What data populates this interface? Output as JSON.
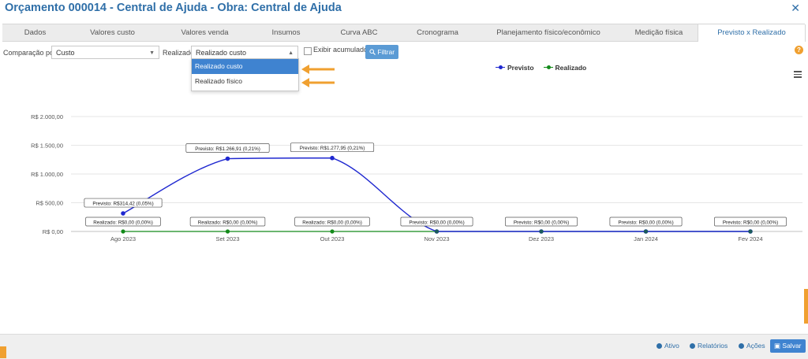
{
  "window": {
    "title": "Orçamento 000014 - Central de Ajuda - Obra: Central de Ajuda",
    "close_icon": "✕"
  },
  "tabs": [
    {
      "label": "Dados"
    },
    {
      "label": "Valores custo"
    },
    {
      "label": "Valores venda"
    },
    {
      "label": "Insumos"
    },
    {
      "label": "Curva ABC"
    },
    {
      "label": "Cronograma"
    },
    {
      "label": "Planejamento físico/econômico"
    },
    {
      "label": "Medição física"
    },
    {
      "label": "Previsto x Realizado"
    }
  ],
  "filters": {
    "comparacao_label": "Comparação por",
    "comparacao_value": "Custo",
    "realizado_label": "Realizado",
    "realizado_value": "Realizado custo",
    "realizado_options": [
      "Realizado custo",
      "Realizado físico"
    ],
    "exibir_acumulado_label": "Exibir acumulado",
    "filtrar_label": "Filtrar"
  },
  "colors": {
    "accent": "#2f6fa8",
    "previsto": "#1f28d0",
    "realizado": "#138a1a",
    "arrow": "#f0a030"
  },
  "chart_data": {
    "type": "line",
    "categories": [
      "Ago 2023",
      "Set 2023",
      "Out 2023",
      "Nov 2023",
      "Dez 2023",
      "Jan 2024",
      "Fev 2024"
    ],
    "y_ticks": [
      "R$ 0,00",
      "R$ 500,00",
      "R$ 1.000,00",
      "R$ 1.500,00",
      "R$ 2.000,00"
    ],
    "ylim": [
      0,
      2000
    ],
    "grid": true,
    "legend_position": "top-center",
    "series": [
      {
        "name": "Previsto",
        "values": [
          314.42,
          1266.91,
          1277.95,
          0,
          0,
          0,
          0
        ],
        "labels": [
          "Previsto: R$314,42 (0,05%)",
          "Previsto: R$1.266,91 (0,21%)",
          "Previsto: R$1.277,95 (0,21%)",
          "Previsto: R$0,00 (0,00%)",
          "Previsto: R$0,00 (0,00%)",
          "Previsto: R$0,00 (0,00%)",
          "Previsto: R$0,00 (0,00%)"
        ]
      },
      {
        "name": "Realizado",
        "values": [
          0,
          0,
          0,
          0,
          0,
          0,
          0
        ],
        "labels": [
          "Realizado: R$0,00 (0,00%)",
          "Realizado: R$0,00 (0,00%)",
          "Realizado: R$0,00 (0,00%)",
          "",
          "",
          "",
          ""
        ]
      }
    ]
  },
  "footer": {
    "ativo_label": "Ativo",
    "relatorios_label": "Relatórios",
    "acoes_label": "Ações",
    "salvar_label": "Salvar"
  }
}
